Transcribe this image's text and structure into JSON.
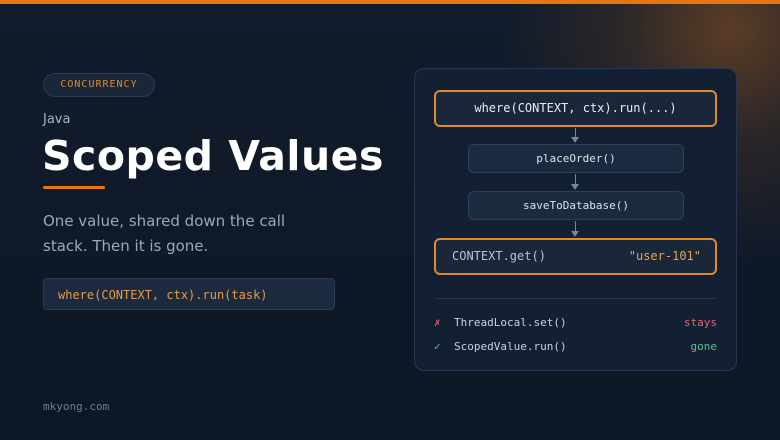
{
  "badge": "CONCURRENCY",
  "language": "Java",
  "title": "Scoped Values",
  "description": "One value, shared down the call stack. Then it is gone.",
  "code_snippet": "where(CONTEXT, ctx).run(task)",
  "footer": "mkyong.com",
  "diagram": {
    "top_node": "where(CONTEXT, ctx).run(...)",
    "step1": "placeOrder()",
    "step2": "saveToDatabase()",
    "result_call": "CONTEXT.get()",
    "result_value": "\"user-101\""
  },
  "comparison": [
    {
      "mark": "✗",
      "label": "ThreadLocal.set()",
      "status": "stays"
    },
    {
      "mark": "✓",
      "label": "ScopedValue.run()",
      "status": "gone"
    }
  ],
  "colors": {
    "accent": "#e8760f",
    "bad": "#e06a6a",
    "good": "#5fbf86"
  }
}
